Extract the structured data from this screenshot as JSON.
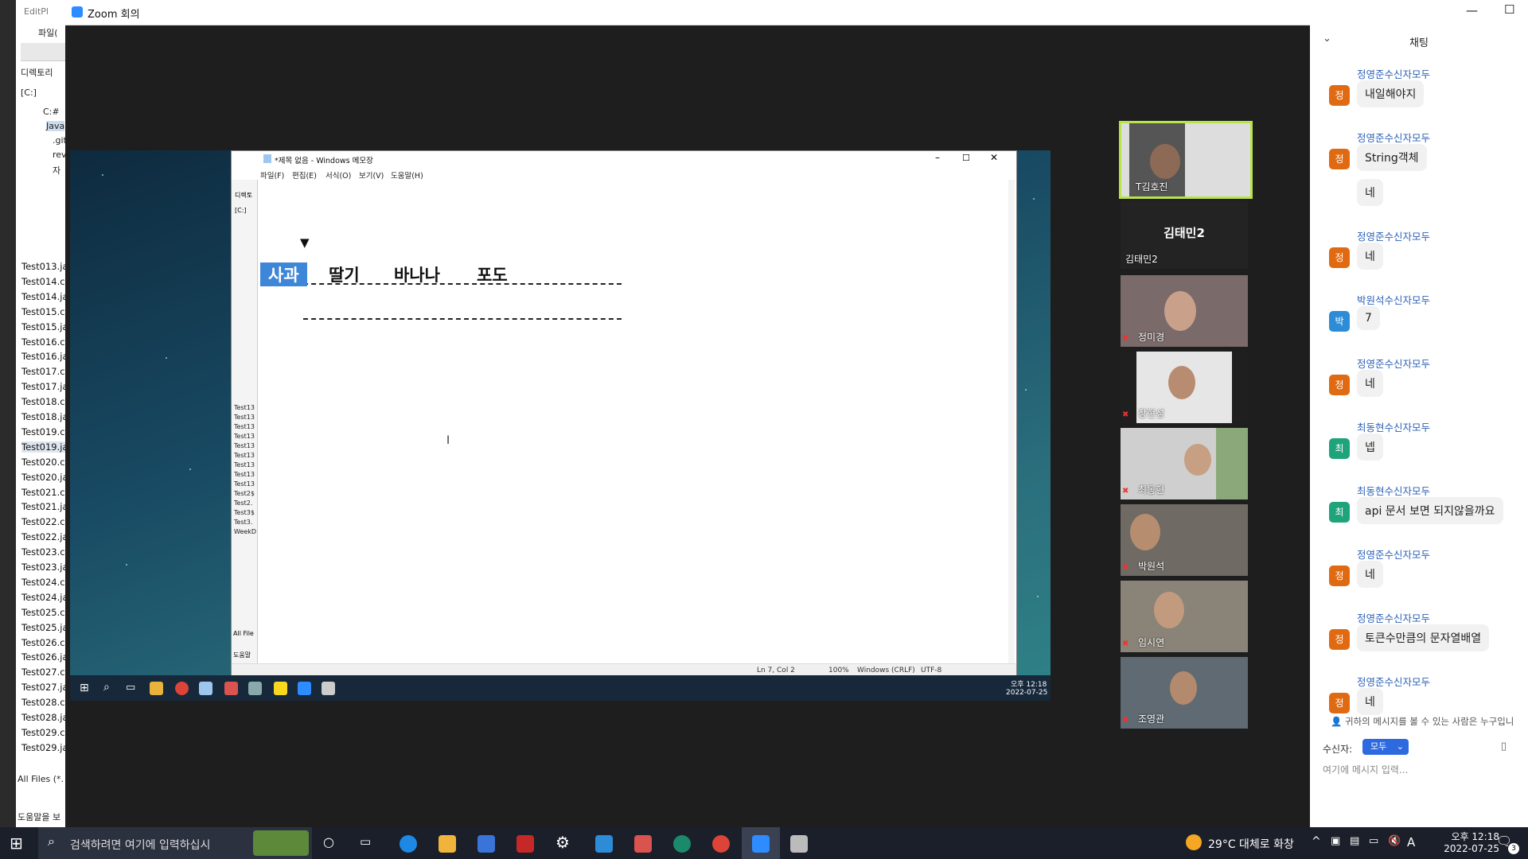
{
  "bg_app": {
    "title": "EditPl",
    "menu_file": "파일(",
    "directory": "디렉토리",
    "drive": "[C:]",
    "folders": [
      "C:#",
      "Java",
      ".git",
      "rev",
      "자"
    ],
    "files": [
      "Test013.ja",
      "Test014.cl",
      "Test014.ja",
      "Test015.cl",
      "Test015.ja",
      "Test016.cl",
      "Test016.ja",
      "Test017.cl",
      "Test017.ja",
      "Test018.cl",
      "Test018.ja",
      "Test019.cl",
      "Test019.ja",
      "Test020.cl",
      "Test020.ja",
      "Test021.cl",
      "Test021.ja",
      "Test022.cl",
      "Test022.ja",
      "Test023.cl",
      "Test023.ja",
      "Test024.cl",
      "Test024.ja",
      "Test025.cl",
      "Test025.ja",
      "Test026.cl",
      "Test026.ja",
      "Test027.cl",
      "Test027.ja",
      "Test028.cl",
      "Test028.ja",
      "Test029.cl",
      "Test029.ja"
    ],
    "filter": "All Files (*.",
    "help": "도움말을 보"
  },
  "zoom": {
    "title": "Zoom 회의"
  },
  "notepad": {
    "title": "*제목 없음 - Windows 메모장",
    "menu": [
      "파일(F)",
      "편집(E)",
      "서식(O)",
      "보기(V)",
      "도움말(H)"
    ],
    "arrow": "▼",
    "words": [
      "사과",
      "딸기",
      "바나나",
      "포도"
    ],
    "status": {
      "position": "Ln 7, Col 2",
      "zoom": "100%",
      "line_ending": "Windows (CRLF)",
      "encoding": "UTF-8"
    },
    "inner_side_items": [
      "Test13",
      "Test13",
      "Test13",
      "Test13",
      "Test13",
      "Test13",
      "Test13",
      "Test13",
      "Test13",
      "Test2$",
      "Test2.",
      "Test3$",
      "Test3.",
      "WeekD"
    ],
    "inner_all_files": "All File",
    "inner_help": "도움말",
    "inner_drive": "[C:]",
    "inner_directory": "디렉토"
  },
  "inner_clock": {
    "time": "오후 12:18",
    "date": "2022-07-25"
  },
  "participants": [
    {
      "name": "T김호진"
    },
    {
      "name": "김태민2",
      "big_label": "김태민2"
    },
    {
      "name": "정미경"
    },
    {
      "name": "장현성"
    },
    {
      "name": "최동현"
    },
    {
      "name": "박원석"
    },
    {
      "name": "임시연"
    },
    {
      "name": "조영관"
    }
  ],
  "chat": {
    "title": "채팅",
    "messages": [
      {
        "sender": "정영준수신자모두",
        "initial": "정",
        "color": "#e06a12",
        "texts": [
          "내일해야지"
        ]
      },
      {
        "sender": "정영준수신자모두",
        "initial": "정",
        "color": "#e06a12",
        "texts": [
          "String객체",
          "네"
        ]
      },
      {
        "sender": "정영준수신자모두",
        "initial": "정",
        "color": "#e06a12",
        "texts": [
          "네"
        ]
      },
      {
        "sender": "박원석수신자모두",
        "initial": "박",
        "color": "#2d8cd8",
        "texts": [
          "7"
        ]
      },
      {
        "sender": "정영준수신자모두",
        "initial": "정",
        "color": "#e06a12",
        "texts": [
          "네"
        ]
      },
      {
        "sender": "최동현수신자모두",
        "initial": "최",
        "color": "#1ea37a",
        "texts": [
          "넵"
        ]
      },
      {
        "sender": "최동현수신자모두",
        "initial": "최",
        "color": "#1ea37a",
        "texts": [
          "api 문서 보면 되지않을까요"
        ]
      },
      {
        "sender": "정영준수신자모두",
        "initial": "정",
        "color": "#e06a12",
        "texts": [
          "네"
        ]
      },
      {
        "sender": "정영준수신자모두",
        "initial": "정",
        "color": "#e06a12",
        "texts": [
          "토큰수만큼의 문자열배열"
        ]
      },
      {
        "sender": "정영준수신자모두",
        "initial": "정",
        "color": "#e06a12",
        "texts": [
          "네"
        ]
      }
    ],
    "visibility_note": "귀하의 메시지를 볼 수 있는 사람은 누구입니",
    "recipient_label": "수신자:",
    "recipient_value": "모두",
    "input_placeholder": "여기에 메시지 입력..."
  },
  "taskbar": {
    "search_placeholder": "검색하려면 여기에 입력하십시",
    "weather": "29°C 대체로 화창",
    "ime": "A",
    "time": "오후 12:18",
    "date": "2022-07-25",
    "notifications": "3"
  }
}
